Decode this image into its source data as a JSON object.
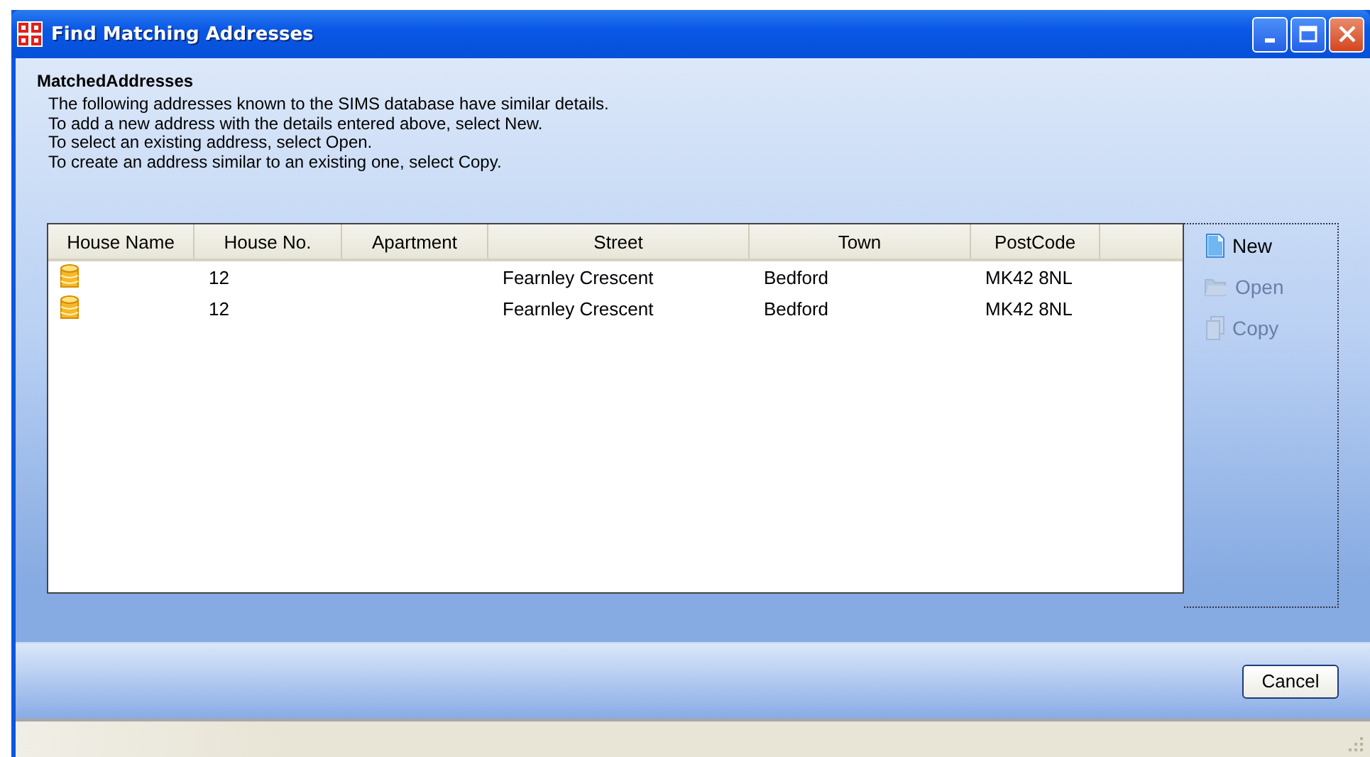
{
  "window": {
    "title": "Find Matching Addresses"
  },
  "section": {
    "title": "MatchedAddresses",
    "lines": [
      "The following addresses known to the SIMS database have similar details.",
      "To add a new address with the details entered above, select New.",
      "To select an existing address, select Open.",
      "To create an address similar to an existing one, select Copy."
    ]
  },
  "table": {
    "columns": [
      "House Name",
      "House No.",
      "Apartment",
      "Street",
      "Town",
      "PostCode"
    ],
    "rows": [
      {
        "house_no": "12",
        "street": "Fearnley Crescent",
        "town": "Bedford",
        "postcode": "MK42 8NL"
      },
      {
        "house_no": "12",
        "street": "Fearnley Crescent",
        "town": "Bedford",
        "postcode": "MK42 8NL"
      }
    ]
  },
  "actions": [
    {
      "kind": "new",
      "label": "New",
      "disabled": false
    },
    {
      "kind": "open",
      "label": "Open",
      "disabled": true
    },
    {
      "kind": "copy",
      "label": "Copy",
      "disabled": true
    }
  ],
  "buttons": [
    "Cancel"
  ]
}
